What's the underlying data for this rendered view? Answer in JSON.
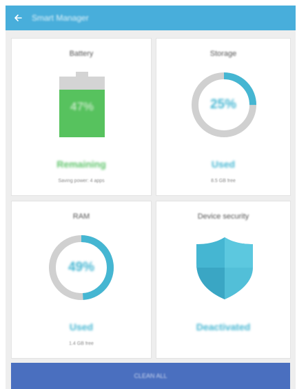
{
  "header": {
    "title": "Smart Manager",
    "back_icon": "arrow-left-icon"
  },
  "cards": {
    "battery": {
      "title": "Battery",
      "level": "47%",
      "level_fraction": 0.47,
      "status": "Remaining",
      "detail": "Saving power: 4 apps"
    },
    "storage": {
      "title": "Storage",
      "percent": "25%",
      "used_fraction": 0.25,
      "status": "Used",
      "detail": "8.5 GB free"
    },
    "ram": {
      "title": "RAM",
      "percent": "49%",
      "used_fraction": 0.49,
      "status": "Used",
      "detail": "1.4 GB free"
    },
    "security": {
      "title": "Device security",
      "status": "Deactivated",
      "icon": "shield-icon"
    }
  },
  "footer": {
    "button_label": "CLEAN ALL"
  },
  "colors": {
    "appbar": "#48aedb",
    "accent_blue": "#45b6d2",
    "battery_green": "#57c25e",
    "status_green": "#5ec46a",
    "ring_gray": "#d0d0d0",
    "clean_button": "#4a6fbf"
  }
}
